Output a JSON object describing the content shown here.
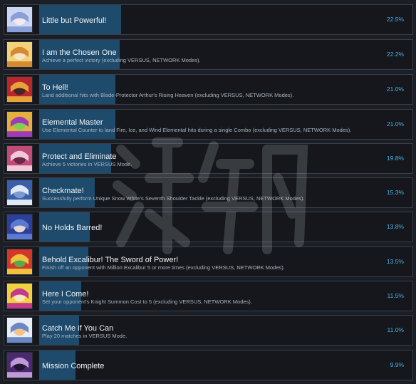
{
  "achievements": [
    {
      "title": "Little but Powerful!",
      "desc": "",
      "percent": "22.5%",
      "fill": 0.225,
      "icon": "character-portrait-icon",
      "colors": [
        "#cbd6f4",
        "#8a9fd8",
        "#f3e8f0"
      ]
    },
    {
      "title": "I am the Chosen One",
      "desc": "Achieve a perfect victory (excluding VERSUS, NETWORK Modes).",
      "percent": "22.2%",
      "fill": 0.222,
      "icon": "character-portrait-icon",
      "colors": [
        "#f2d27a",
        "#d48a2e",
        "#f6e3c7"
      ]
    },
    {
      "title": "To Hell!",
      "desc": "Land additional hits with Blade-Protector Arthur's Rising Heaven (excluding VERSUS, NETWORK Modes).",
      "percent": "21.0%",
      "fill": 0.21,
      "icon": "character-portrait-icon",
      "colors": [
        "#b8272b",
        "#e9a23a",
        "#442626"
      ]
    },
    {
      "title": "Elemental Master",
      "desc": "Use Elemental Counter to land Fire, Ice, and Wind Elemental hits during a single Combo (excluding VERSUS, NETWORK Modes).",
      "percent": "21.0%",
      "fill": 0.21,
      "icon": "character-portrait-icon",
      "colors": [
        "#e2b13c",
        "#9f3bb8",
        "#7ad14e"
      ]
    },
    {
      "title": "Protect and Eliminate",
      "desc": "Achieve 5 victories in VERSUS Mode.",
      "percent": "19.8%",
      "fill": 0.198,
      "icon": "character-portrait-icon",
      "colors": [
        "#c24a78",
        "#f1c9d9",
        "#6a2a45"
      ]
    },
    {
      "title": "Checkmate!",
      "desc": "Successfully perform Unique Snow White's Seventh Shoulder Tackle (excluding VERSUS, NETWORK Modes).",
      "percent": "15.3%",
      "fill": 0.153,
      "icon": "character-portrait-icon",
      "colors": [
        "#3a5fa8",
        "#dfe8f6",
        "#7e98d0"
      ]
    },
    {
      "title": "No Holds Barred!",
      "desc": "",
      "percent": "13.8%",
      "fill": 0.138,
      "icon": "character-portrait-icon",
      "colors": [
        "#2c3f9a",
        "#5b7ad1",
        "#e7d7cc"
      ]
    },
    {
      "title": "Behold Excalibur! The Sword of Power!",
      "desc": "Finish off an opponent with Million Excalibur 5 or more times (excluding VERSUS, NETWORK Modes).",
      "percent": "13.5%",
      "fill": 0.135,
      "icon": "character-portrait-icon",
      "colors": [
        "#d2372a",
        "#f0c23e",
        "#5aa84c"
      ]
    },
    {
      "title": "Here I Come!",
      "desc": "Set your opponent's Knight Summon Cost to 5 (excluding VERSUS, NETWORK Modes).",
      "percent": "11.5%",
      "fill": 0.115,
      "icon": "character-portrait-icon",
      "colors": [
        "#f0d23f",
        "#c43a8a",
        "#f6e6c0"
      ]
    },
    {
      "title": "Catch Me if You Can",
      "desc": "Play 20 matches in VERSUS Mode.",
      "percent": "11.0%",
      "fill": 0.11,
      "icon": "character-portrait-icon",
      "colors": [
        "#e9eef6",
        "#6b88c6",
        "#f2c48c"
      ]
    },
    {
      "title": "Mission Complete",
      "desc": "",
      "percent": "9.9%",
      "fill": 0.099,
      "icon": "character-portrait-icon",
      "colors": [
        "#4a2a6e",
        "#c09ad8",
        "#241632"
      ]
    }
  ]
}
